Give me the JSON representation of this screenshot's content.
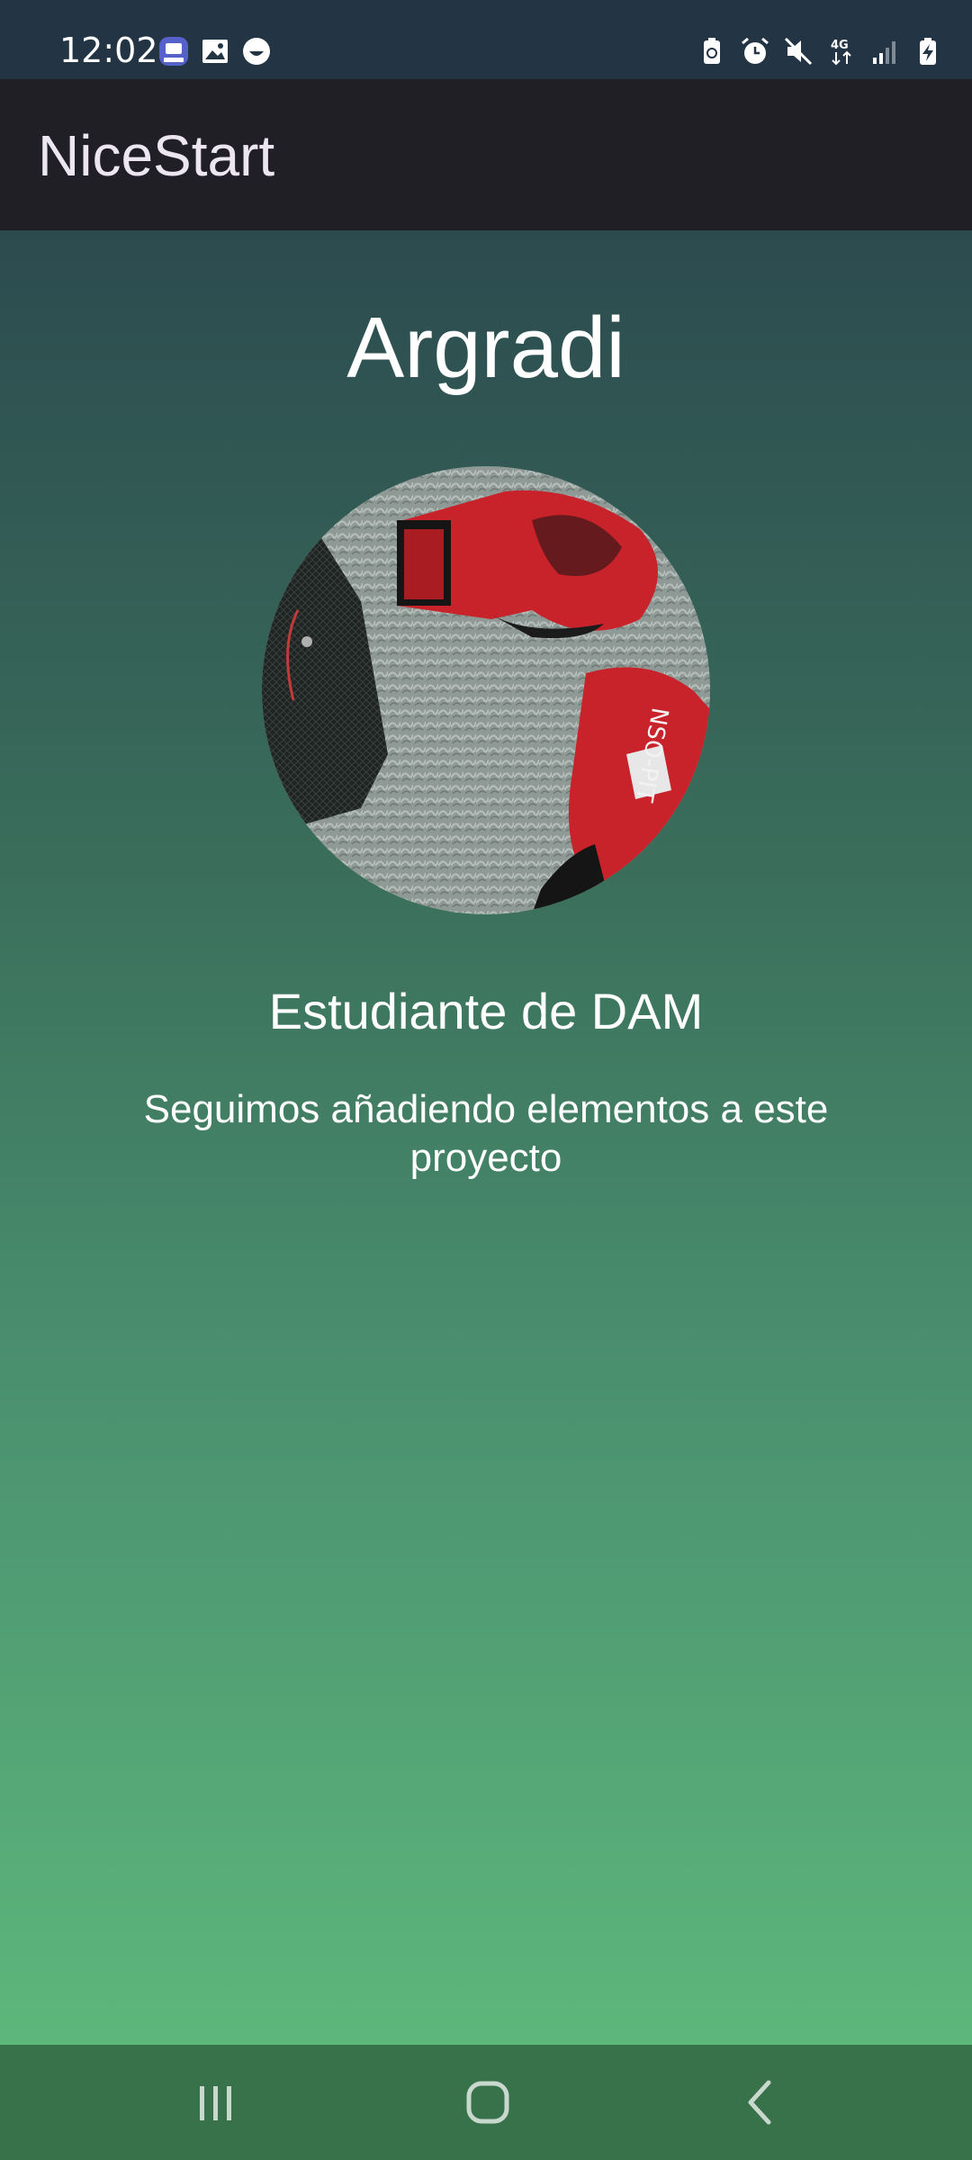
{
  "status_bar": {
    "time": "12:02",
    "left_icons": [
      "tv-app-icon",
      "image-icon",
      "smiley-icon"
    ],
    "right_icons": [
      "battery-saver-icon",
      "alarm-icon",
      "mute-icon",
      "network-4g-icon",
      "signal-icon",
      "battery-charging-icon"
    ],
    "network_label": "4G"
  },
  "app_bar": {
    "title": "NiceStart"
  },
  "profile": {
    "name": "Argradi",
    "image": "boxing-gloves-photo",
    "subtitle": "Estudiante de DAM",
    "description": "Seguimos añadiendo elementos a este proyecto"
  },
  "nav_bar": {
    "buttons": [
      "recent-apps-icon",
      "home-icon",
      "back-icon"
    ]
  },
  "colors": {
    "status_bar": "#233444",
    "app_bar": "#211f26",
    "gradient_top": "#2c4b4f",
    "gradient_bottom": "#5db77b",
    "nav_bar": "#38724b"
  }
}
